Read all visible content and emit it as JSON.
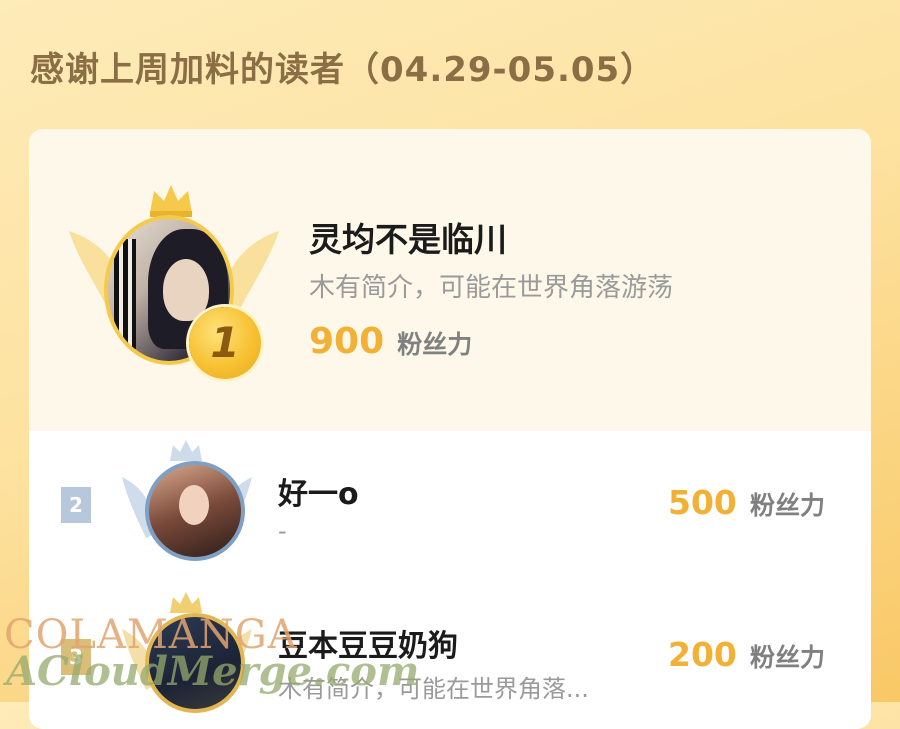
{
  "header": {
    "title": "感谢上周加料的读者（04.29-05.05）"
  },
  "ranking": {
    "first": {
      "rank": "1",
      "name": "灵均不是临川",
      "bio": "木有简介，可能在世界角落游荡",
      "points": "900",
      "unit": "粉丝力"
    },
    "others": [
      {
        "rank": "2",
        "name": "好一o",
        "bio": "-",
        "points": "500",
        "unit": "粉丝力"
      },
      {
        "rank": "3",
        "name": "豆本豆豆奶狗",
        "bio": "木有简介，可能在世界角落...",
        "points": "200",
        "unit": "粉丝力"
      }
    ]
  },
  "watermark": {
    "line1": "COLAMANGA",
    "line2": "ACloudMerge.com"
  },
  "colors": {
    "accent_gold": "#f2b135",
    "title_brown": "#8a6e45",
    "silver_border": "#7f9fc4"
  }
}
